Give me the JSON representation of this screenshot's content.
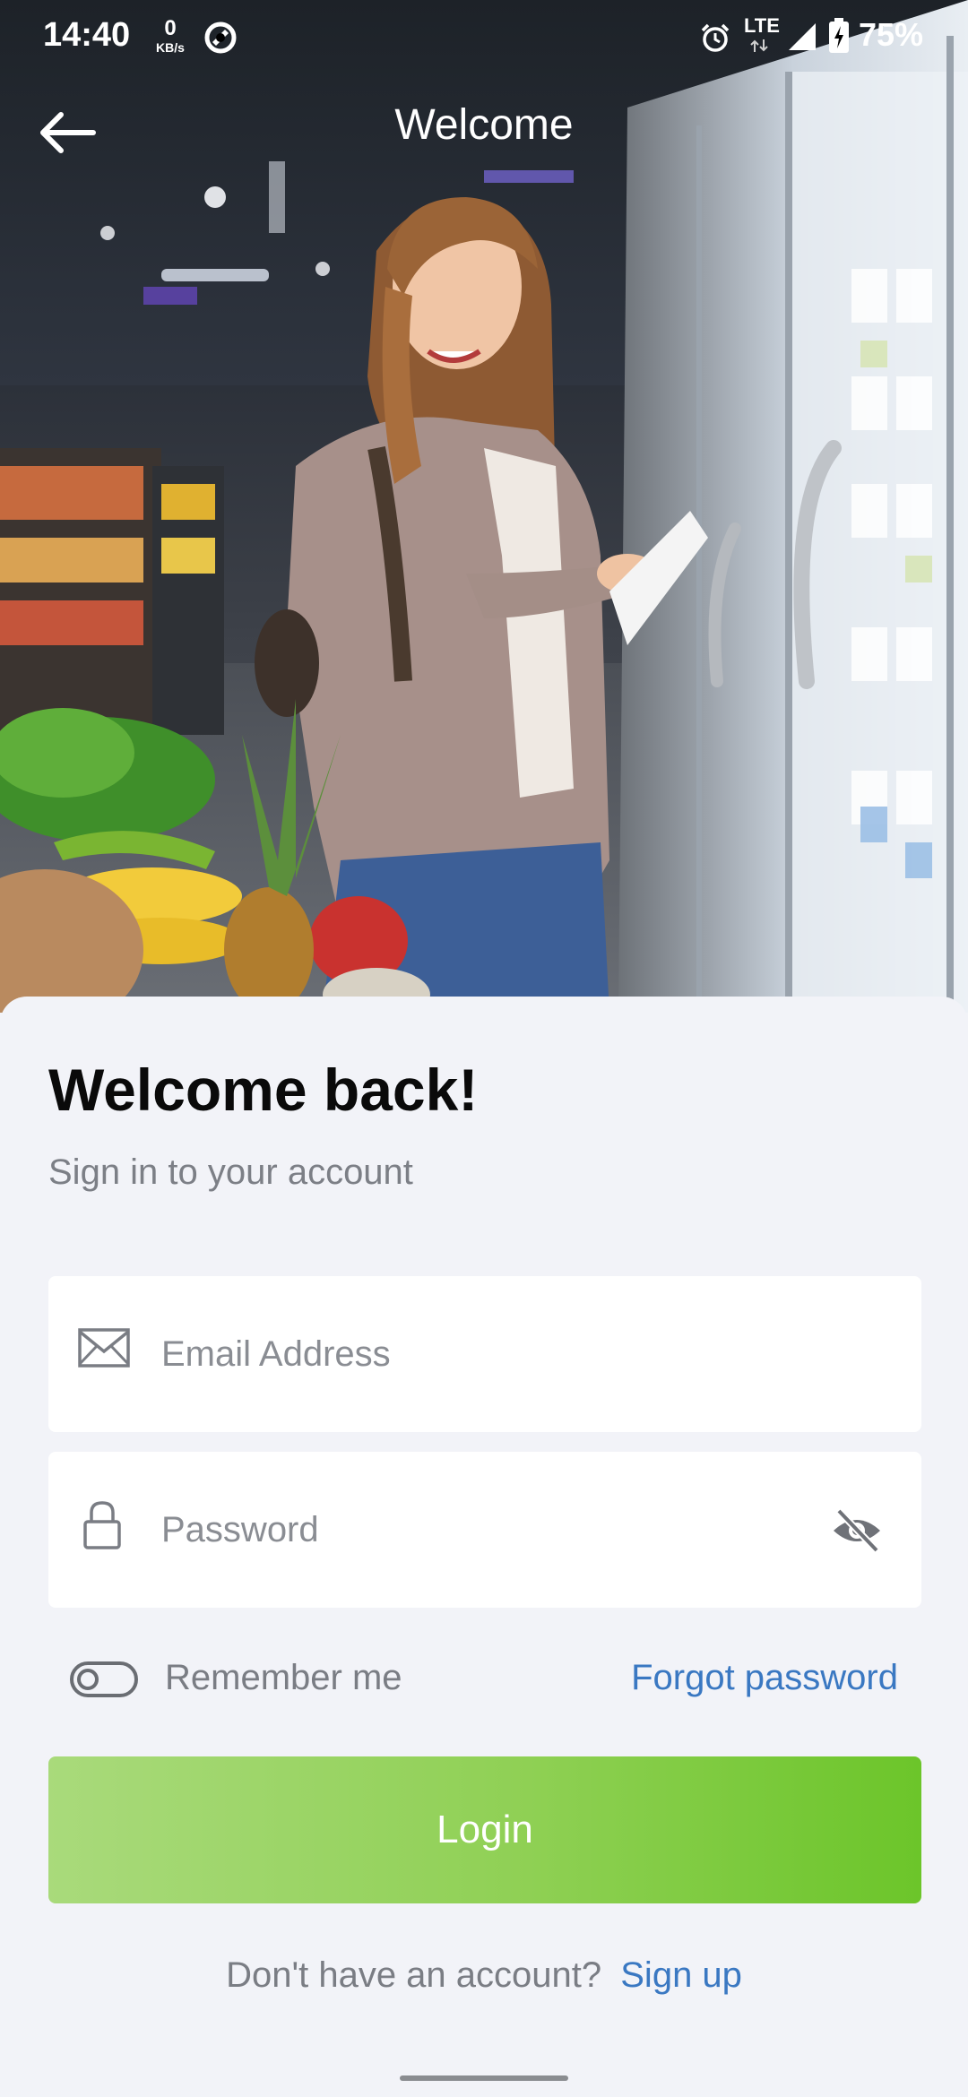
{
  "status_bar": {
    "time": "14:40",
    "net_speed_value": "0",
    "net_speed_unit": "KB/s",
    "network": "LTE",
    "battery": "75%",
    "icons": [
      "app-notification-icon",
      "alarm-icon",
      "signal-icon",
      "battery-charging-icon"
    ]
  },
  "app_bar": {
    "title": "Welcome",
    "back_icon": "arrow-left-icon"
  },
  "hero": {
    "image": "woman-shopping-in-supermarket-photo"
  },
  "login": {
    "heading": "Welcome back!",
    "subheading": "Sign in to your account",
    "email": {
      "icon": "envelope-icon",
      "placeholder": "Email Address",
      "value": ""
    },
    "password": {
      "icon": "lock-icon",
      "placeholder": "Password",
      "value": "",
      "visibility_icon": "eye-off-icon"
    },
    "remember_me": {
      "label": "Remember me",
      "checked": false
    },
    "forgot_password": "Forgot password",
    "login_button": "Login",
    "signup_prompt": "Don't have an account?",
    "signup_link": "Sign up"
  },
  "colors": {
    "link": "#3a78c2",
    "button_gradient_start": "#a9da7b",
    "button_gradient_end": "#6cc52a",
    "background": "#f2f3f8"
  }
}
